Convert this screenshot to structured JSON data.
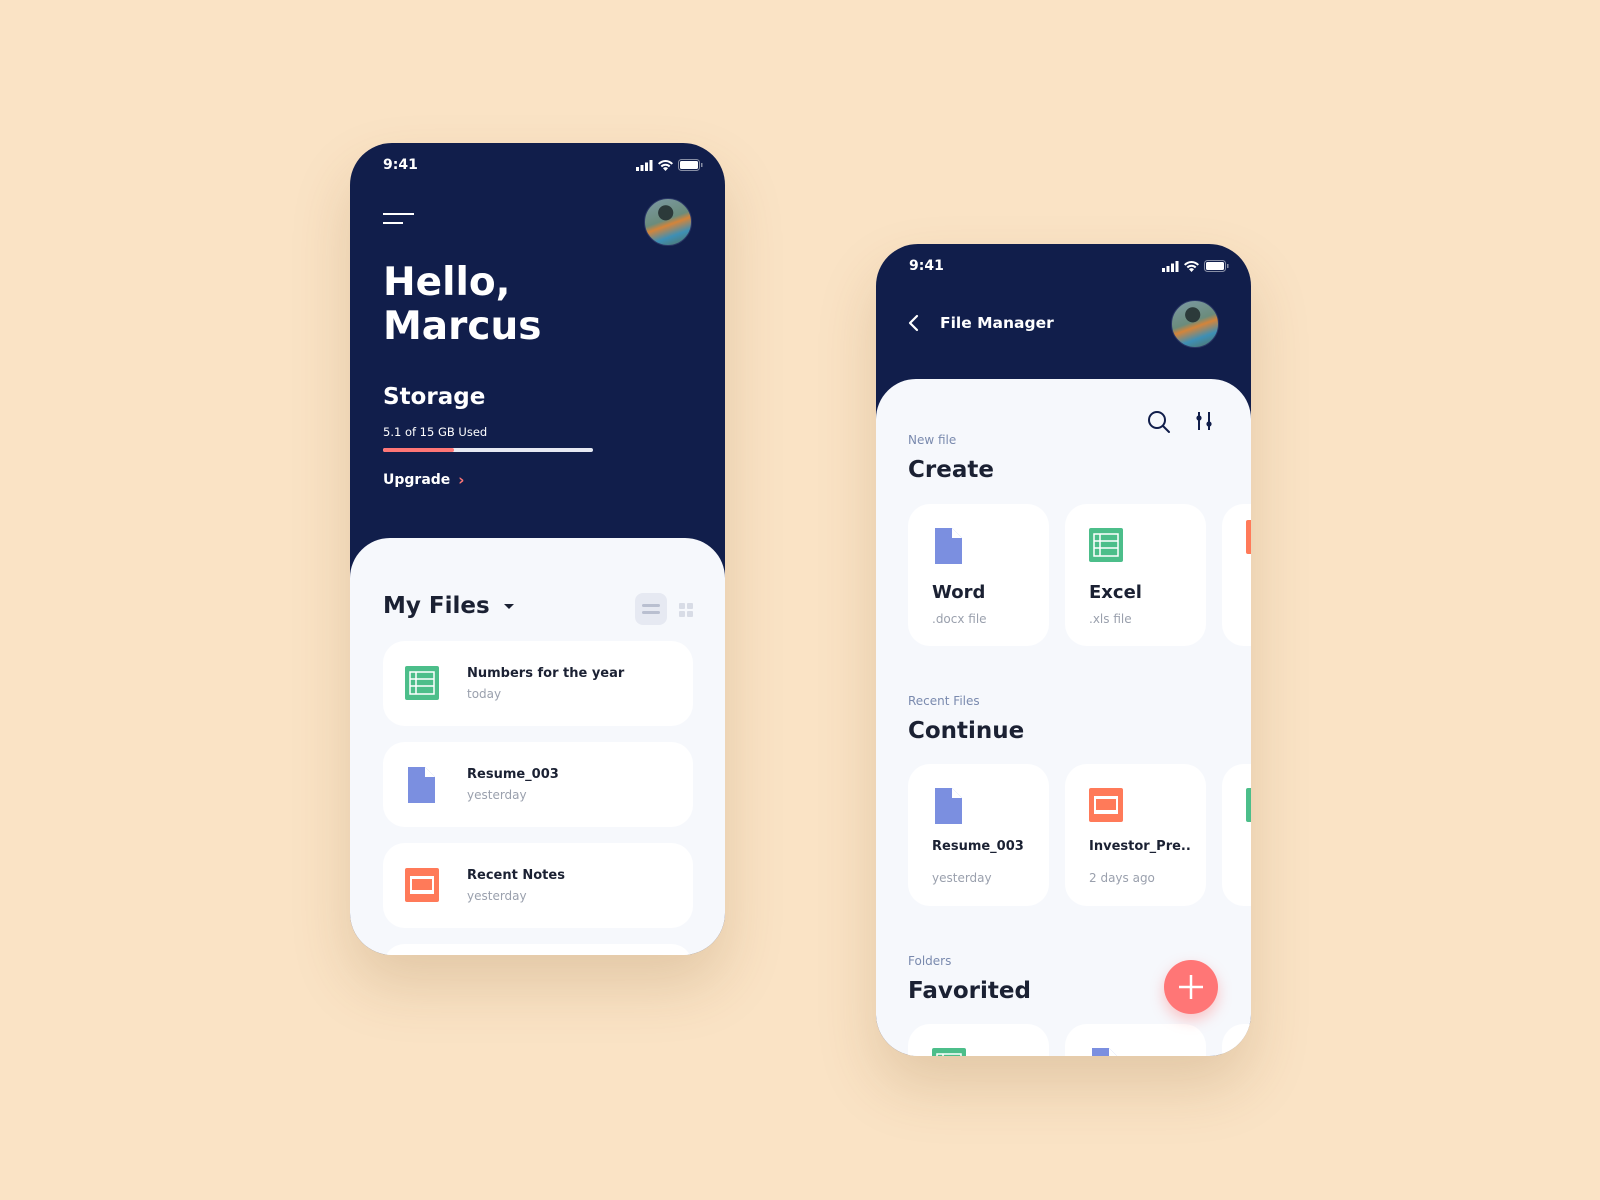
{
  "colors": {
    "navy": "#111e4b",
    "accent": "#ff7676",
    "green": "#4cbe8a",
    "blue": "#7b8fe0",
    "orange": "#ff7a59",
    "background": "#fae3c5"
  },
  "phone1": {
    "status_time": "9:41",
    "greeting_line1": "Hello,",
    "greeting_line2": "Marcus",
    "storage": {
      "title": "Storage",
      "usage": "5.1 of 15 GB Used",
      "used_fraction": 0.34
    },
    "upgrade_label": "Upgrade",
    "my_files": {
      "title": "My Files",
      "view": "list",
      "files": [
        {
          "name": "Numbers for the year",
          "date": "today",
          "icon": "spreadsheet-icon"
        },
        {
          "name": "Resume_003",
          "date": "yesterday",
          "icon": "document-icon"
        },
        {
          "name": "Recent Notes",
          "date": "yesterday",
          "icon": "presentation-icon"
        }
      ]
    }
  },
  "phone2": {
    "status_time": "9:41",
    "header_title": "File Manager",
    "create": {
      "overline": "New file",
      "title": "Create",
      "items": [
        {
          "name": "Word",
          "type": ".docx file",
          "icon": "document-icon"
        },
        {
          "name": "Excel",
          "type": ".xls file",
          "icon": "spreadsheet-icon"
        }
      ]
    },
    "continue": {
      "overline": "Recent Files",
      "title": "Continue",
      "items": [
        {
          "name": "Resume_003",
          "date": "yesterday",
          "icon": "document-icon"
        },
        {
          "name": "Investor_Pre..",
          "date": "2 days ago",
          "icon": "presentation-icon"
        }
      ]
    },
    "favorited": {
      "overline": "Folders",
      "title": "Favorited"
    }
  }
}
